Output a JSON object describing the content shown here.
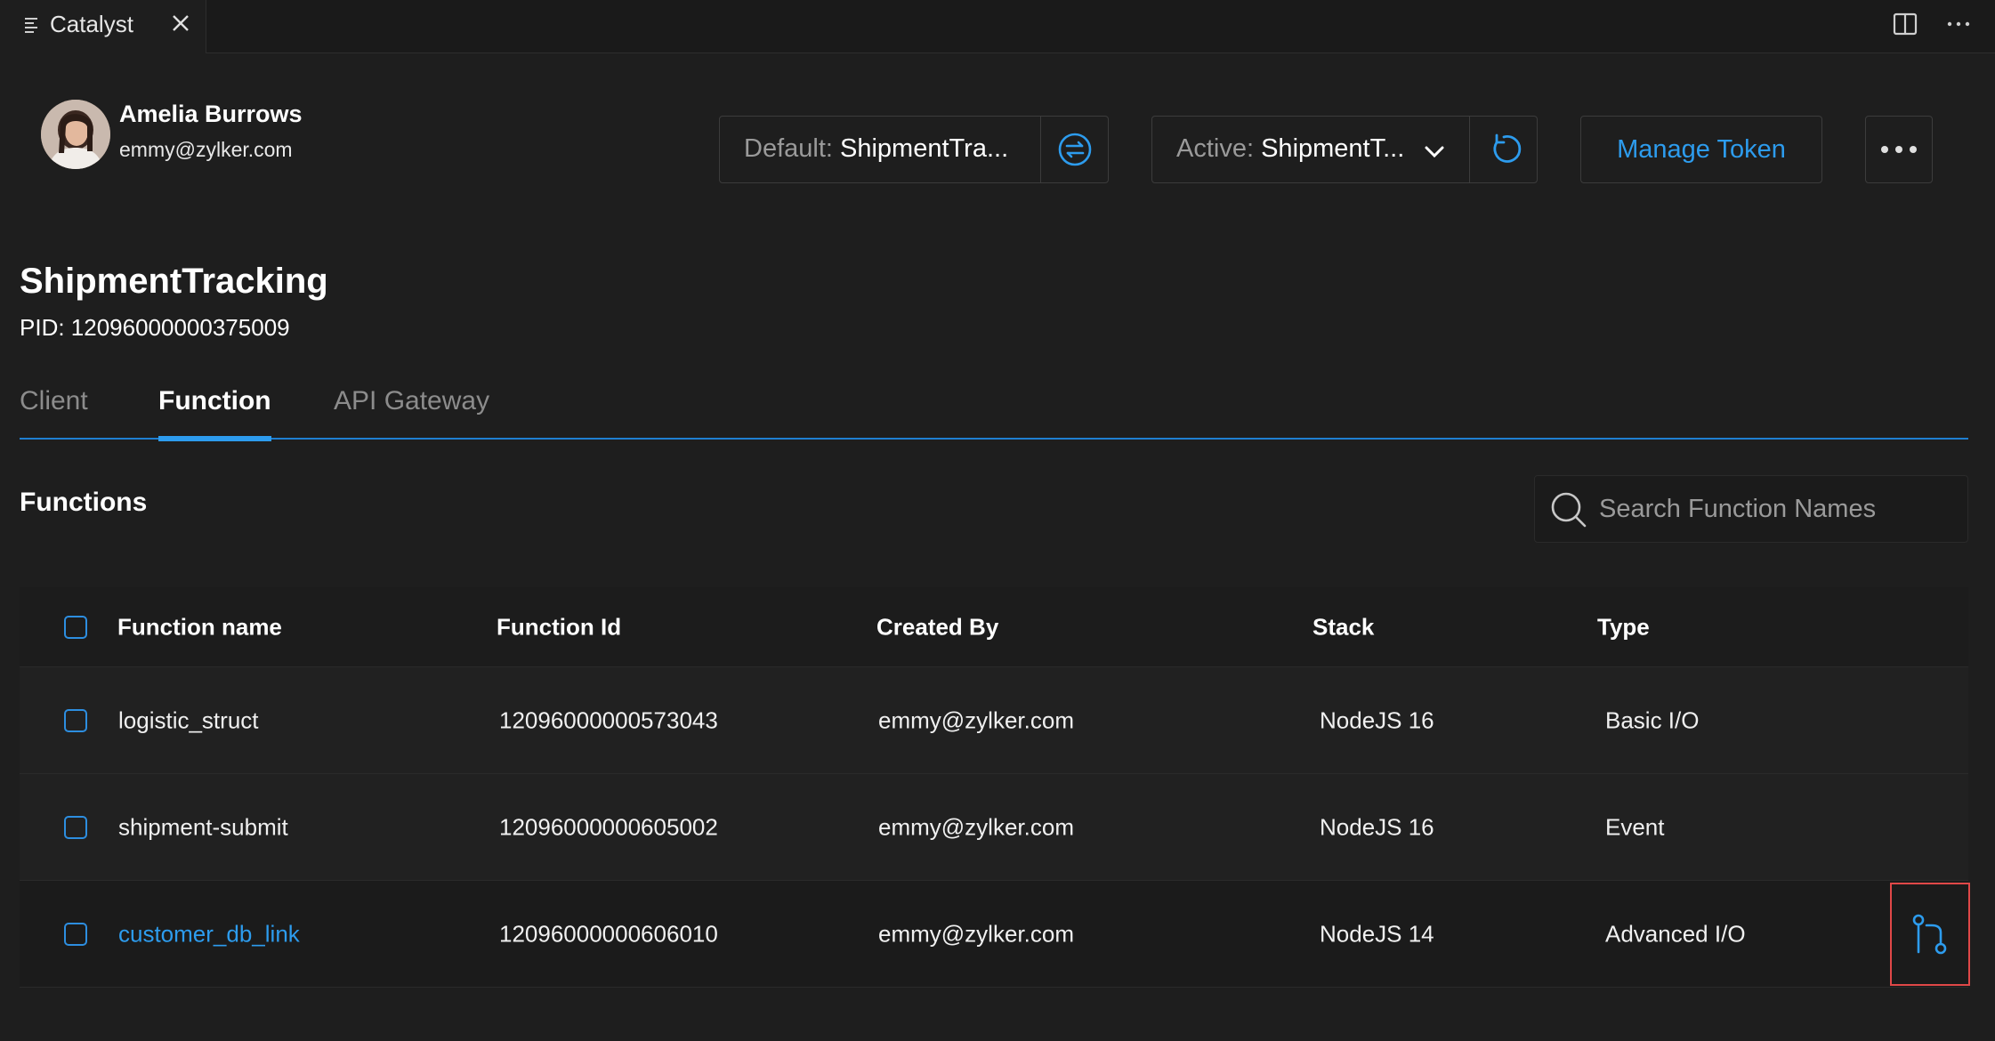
{
  "tab": {
    "title": "Catalyst"
  },
  "user": {
    "name": "Amelia Burrows",
    "email": "emmy@zylker.com"
  },
  "default_project": {
    "key": "Default:",
    "value": "ShipmentTra..."
  },
  "active_project": {
    "key": "Active:",
    "value": "ShipmentT..."
  },
  "manage_token_label": "Manage Token",
  "project": {
    "name": "ShipmentTracking",
    "pid": "PID: 12096000000375009"
  },
  "tabs": [
    "Client",
    "Function",
    "API Gateway"
  ],
  "active_tab": "Function",
  "section_title": "Functions",
  "search": {
    "placeholder": "Search Function Names",
    "value": ""
  },
  "table": {
    "headers": [
      "Function name",
      "Function Id",
      "Created By",
      "Stack",
      "Type"
    ],
    "rows": [
      {
        "name": "logistic_struct",
        "id": "12096000000573043",
        "created_by": "emmy@zylker.com",
        "stack": "NodeJS 16",
        "type": "Basic I/O"
      },
      {
        "name": "shipment-submit",
        "id": "12096000000605002",
        "created_by": "emmy@zylker.com",
        "stack": "NodeJS 16",
        "type": "Event"
      },
      {
        "name": "customer_db_link",
        "id": "12096000000606010",
        "created_by": "emmy@zylker.com",
        "stack": "NodeJS 14",
        "type": "Advanced I/O"
      }
    ]
  },
  "colors": {
    "accent": "#2d9cee",
    "background": "#1e1e1e",
    "highlight": "#e04848"
  },
  "icons": {
    "tab_menu": "list-icon",
    "tab_close": "close-icon",
    "split": "split-editor-icon",
    "overflow": "ellipsis-icon",
    "switch": "switch-icon",
    "dropdown": "chevron-down-icon",
    "refresh": "refresh-icon",
    "more": "more-icon",
    "search": "search-icon",
    "row_action": "git-compare-icon"
  }
}
